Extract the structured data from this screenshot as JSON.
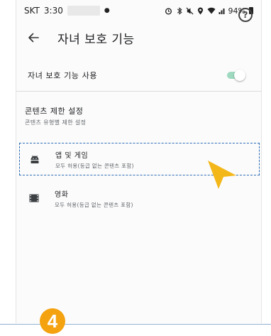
{
  "status_bar": {
    "carrier": "SKT",
    "time": "3:30",
    "battery": "94%"
  },
  "app_bar": {
    "title": "자녀 보호 기능"
  },
  "settings": {
    "parental_toggle_label": "자녀 보호 기능 사용",
    "parental_toggle_on": true
  },
  "content_restrictions": {
    "title": "콘텐츠 제한 설정",
    "subtitle": "콘텐츠 유형별 제한 설정",
    "items": [
      {
        "title": "앱 및 게임",
        "subtitle": "모두 허용(등급 없는 콘텐츠 포함)",
        "icon": "android-icon"
      },
      {
        "title": "영화",
        "subtitle": "모두 허용(등급 없는 콘텐츠 포함)",
        "icon": "film-icon"
      }
    ]
  },
  "annotation": {
    "step_number": "4",
    "highlight_color": "#2d6cb5",
    "pointer_color": "#f4b71a"
  },
  "colors": {
    "toggle_track": "#9ed9c0",
    "badge": "#f4a20f"
  }
}
